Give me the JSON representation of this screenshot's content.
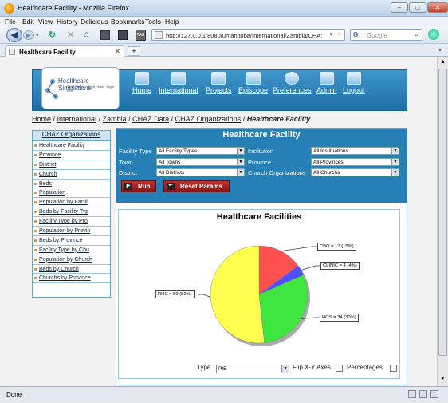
{
  "window": {
    "title": "Healthcare Facility - Mozilla Firefox"
  },
  "menu": [
    "File",
    "Edit",
    "View",
    "History",
    "Delicious",
    "Bookmarks",
    "Tools",
    "Help"
  ],
  "nav": {
    "url": "http://127.0.0.1:8080/umanitoba/International/Zambia/CHA:",
    "search_placeholder": "Google"
  },
  "tab": {
    "title": "Healthcare Facility"
  },
  "status": {
    "text": "Done"
  },
  "site": {
    "logo_title": "Healthcare Simulations",
    "logo_tagline": "Right Patient · Right Place · Right Time",
    "nav": [
      "Home",
      "International",
      "Projects",
      "Episcope",
      "Preferences",
      "Admin",
      "Logout"
    ]
  },
  "breadcrumb": {
    "items": [
      "Home",
      "International",
      "Zambia",
      "CHAZ Data",
      "CHAZ Organizations"
    ],
    "separator": " / ",
    "current": "Healthcare Facility"
  },
  "sidebar": {
    "header": "CHAZ Organizations",
    "items": [
      "Healthcare Facility",
      "Province",
      "District",
      "Church",
      "Beds",
      "Population",
      "Population by Facili",
      "Beds by Facility Typ",
      "Facility Type by Pro",
      "Population by Provin",
      "Beds by Province",
      "Facility Type by Chu",
      "Population by Church",
      "Beds by Church",
      "Churchs by Province"
    ]
  },
  "params": {
    "title": "Healthcare Facility",
    "fields": [
      {
        "label": "Facility Type",
        "value": "All Facility Types"
      },
      {
        "label": "Institution",
        "value": "All Instituations"
      },
      {
        "label": "Town",
        "value": "All Towns"
      },
      {
        "label": "Province",
        "value": "All Provinces"
      },
      {
        "label": "District",
        "value": "All Districts"
      },
      {
        "label": "Church Organizations",
        "value": "All Churchs"
      }
    ],
    "run_label": "Run",
    "reset_label": "Reset Params"
  },
  "chart_data": {
    "type": "pie",
    "title": "Healthcare Facilities",
    "categories": [
      "CBO",
      "CLINIC",
      "HOS",
      "RHC"
    ],
    "values": [
      17,
      4,
      34,
      59
    ],
    "labels": [
      "CBO = 17 (15%)",
      "CLINIC = 4 (4%)",
      "HOS = 34 (30%)",
      "RHC = 59 (52%)"
    ],
    "colors": [
      "#ff4f4f",
      "#4f4fff",
      "#3fe63f",
      "#ffff4f"
    ]
  },
  "controls": {
    "type_label": "Type",
    "type_value": "PIE",
    "flip_label": "Flip X-Y Axes",
    "pct_label": "Percentages"
  }
}
